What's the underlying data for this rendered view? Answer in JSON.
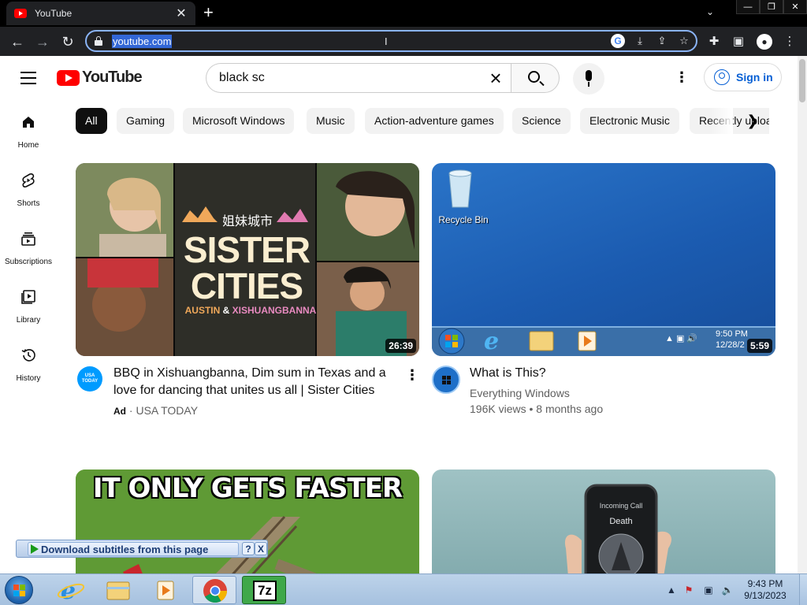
{
  "browser": {
    "tab_title": "YouTube",
    "tab_close": "✕",
    "new_tab": "+",
    "url": "youtube.com",
    "accent": "#8ab4f8"
  },
  "youtube": {
    "logo_text": "YouTube",
    "search_value": "black sc",
    "signin_label": "Sign in",
    "brand_color": "#ff0000"
  },
  "leftnav": {
    "items": [
      {
        "label": "Home",
        "icon": "home-icon"
      },
      {
        "label": "Shorts",
        "icon": "shorts-icon"
      },
      {
        "label": "Subscriptions",
        "icon": "subscriptions-icon"
      },
      {
        "label": "Library",
        "icon": "library-icon"
      },
      {
        "label": "History",
        "icon": "history-icon"
      }
    ]
  },
  "chips": [
    "All",
    "Gaming",
    "Microsoft Windows",
    "Music",
    "Action-adventure games",
    "Science",
    "Electronic Music",
    "Recently uploaded"
  ],
  "videos": [
    {
      "title": "BBQ in Xishuangbanna, Dim sum in Texas and a love for dancing that unites us all | Sister Cities",
      "badge": "Ad",
      "separator": "·",
      "channel": "USA TODAY",
      "duration": "26:39",
      "avatar_text": "USA TODAY",
      "thumb_heading": "SISTER CITIES",
      "thumb_heading_line1": "SISTER",
      "thumb_heading_line2": "CITIES",
      "thumb_chinese": "姐妹城市",
      "thumb_sub_left": "AUSTIN",
      "thumb_sub_amp": "&",
      "thumb_sub_right": "XISHUANGBANNA"
    },
    {
      "title": "What is This?",
      "channel": "Everything Windows",
      "stats": "196K views • 8 months ago",
      "duration": "5:59",
      "thumb_icon_label": "Recycle Bin",
      "thumb_time": "9:50 PM",
      "thumb_date": "12/28/2"
    },
    {
      "thumb_text": "IT ONLY GETS FASTER"
    },
    {
      "thumb_call_label": "Incoming Call",
      "thumb_call_name": "Death"
    }
  ],
  "subtitle_popup": {
    "label": "Download subtitles from this page",
    "help": "?",
    "close": "X"
  },
  "taskbar": {
    "time": "9:43 PM",
    "date": "9/13/2023",
    "sevenzip_label": "7z"
  }
}
